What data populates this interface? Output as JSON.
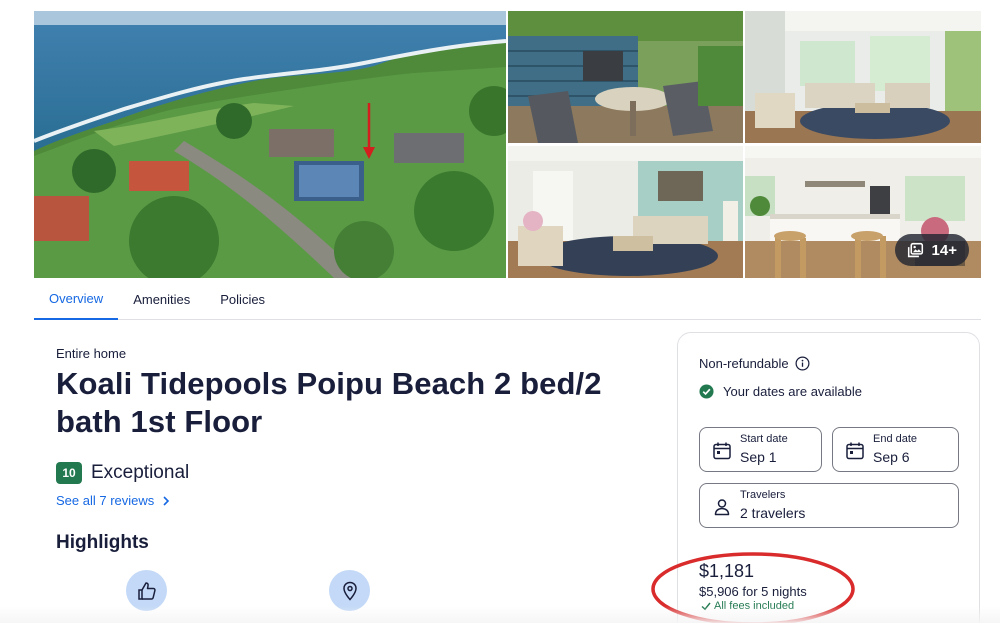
{
  "gallery": {
    "photos": [
      {
        "name": "aerial-coast"
      },
      {
        "name": "patio"
      },
      {
        "name": "living-room"
      },
      {
        "name": "lounge"
      },
      {
        "name": "kitchen"
      }
    ],
    "more_photos_label": "14+",
    "more_photos_icon": "gallery-icon"
  },
  "tabs": [
    {
      "label": "Overview",
      "active": true
    },
    {
      "label": "Amenities",
      "active": false
    },
    {
      "label": "Policies",
      "active": false
    }
  ],
  "property": {
    "type": "Entire home",
    "title": "Koali Tidepools Poipu Beach 2 bed/2 bath 1st Floor"
  },
  "rating": {
    "score": "10",
    "label": "Exceptional",
    "reviews_link": "See all 7 reviews"
  },
  "highlights": {
    "title": "Highlights",
    "icons": [
      "thumbs-up-icon",
      "location-pin-icon"
    ]
  },
  "booking": {
    "refund_policy": "Non-refundable",
    "availability": "Your dates are available",
    "start_date": {
      "label": "Start date",
      "value": "Sep 1"
    },
    "end_date": {
      "label": "End date",
      "value": "Sep 6"
    },
    "travelers": {
      "label": "Travelers",
      "value": "2 travelers"
    },
    "price_per_night": "$1,181",
    "total_price": "$5,906 for 5 nights",
    "fees_note": "All fees included"
  },
  "colors": {
    "accent": "#1668e3",
    "rating_badge": "#227950",
    "available_green": "#227950",
    "annotation_red": "#d92b2b",
    "highlight_icon_bg": "#c3d9f7"
  }
}
